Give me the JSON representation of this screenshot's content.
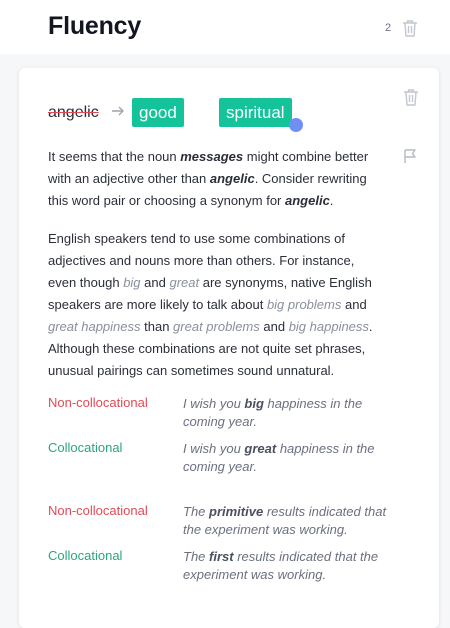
{
  "header": {
    "title": "Fluency",
    "count": "2"
  },
  "card": {
    "original_word": "angelic",
    "suggestions": [
      "good",
      "spiritual"
    ],
    "para1": {
      "t1": "It seems that the noun ",
      "e1": "messages",
      "t2": " might combine better with an adjective other than ",
      "e2": "angelic",
      "t3": ". Consider rewriting this word pair or choosing a synonym for ",
      "e3": "angelic",
      "t4": "."
    },
    "para2": {
      "t1": "English speakers tend to use some combinations of adjectives and nouns more than others. For instance, even though ",
      "x1": "big",
      "t2": " and ",
      "x2": "great",
      "t3": " are synonyms, native English speakers are more likely to talk about ",
      "x3": "big problems",
      "t4": " and ",
      "x4": "great happiness",
      "t5": " than ",
      "x5": "great problems",
      "t6": " and ",
      "x6": "big happiness",
      "t7": ". Although these combinations are not quite set phrases, unusual pairings can sometimes sound unnatural."
    },
    "examples": [
      {
        "label": "Non-collocational",
        "pre": "I wish you ",
        "bold": "big",
        "post": " happiness in the coming year."
      },
      {
        "label": "Collocational",
        "pre": "I wish you ",
        "bold": "great",
        "post": " happiness in the coming year."
      },
      {
        "label": "Non-collocational",
        "pre": "The ",
        "bold": "primitive",
        "post": " results indicated that the experiment was working."
      },
      {
        "label": "Collocational",
        "pre": "The ",
        "bold": "first",
        "post": " results indicated that the experiment was working."
      }
    ]
  },
  "icons": {
    "header_trash": "trash-icon",
    "card_trash": "trash-icon",
    "flag": "flag-icon",
    "arrow": "arrow-right-icon"
  },
  "colors": {
    "accent": "#15c39a",
    "error": "#e24a55",
    "success": "#2aa580",
    "dot": "#6f8ff5"
  }
}
